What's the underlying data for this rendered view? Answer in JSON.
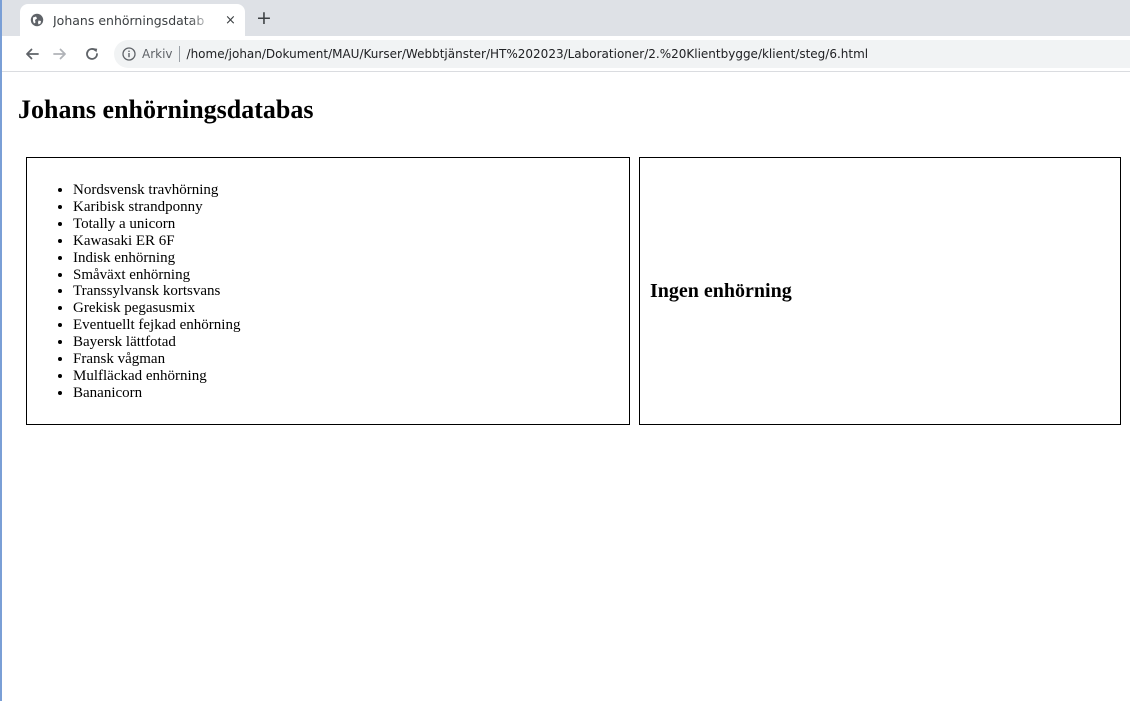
{
  "browser": {
    "tab_title": "Johans enhörningsdatab",
    "security_label": "Arkiv",
    "url": "/home/johan/Dokument/MAU/Kurser/Webbtjänster/HT%202023/Laborationer/2.%20Klientbygge/klient/steg/6.html",
    "close_glyph": "×",
    "newtab_glyph": "+"
  },
  "page": {
    "heading": "Johans enhörningsdatabas",
    "unicorns": [
      "Nordsvensk travhörning",
      "Karibisk strandponny",
      "Totally a unicorn",
      "Kawasaki ER 6F",
      "Indisk enhörning",
      "Småväxt enhörning",
      "Transsylvansk kortsvans",
      "Grekisk pegasusmix",
      "Eventuellt fejkad enhörning",
      "Bayersk lättfotad",
      "Fransk vågman",
      "Mulfläckad enhörning",
      "Bananicorn"
    ],
    "detail_title": "Ingen enhörning"
  }
}
